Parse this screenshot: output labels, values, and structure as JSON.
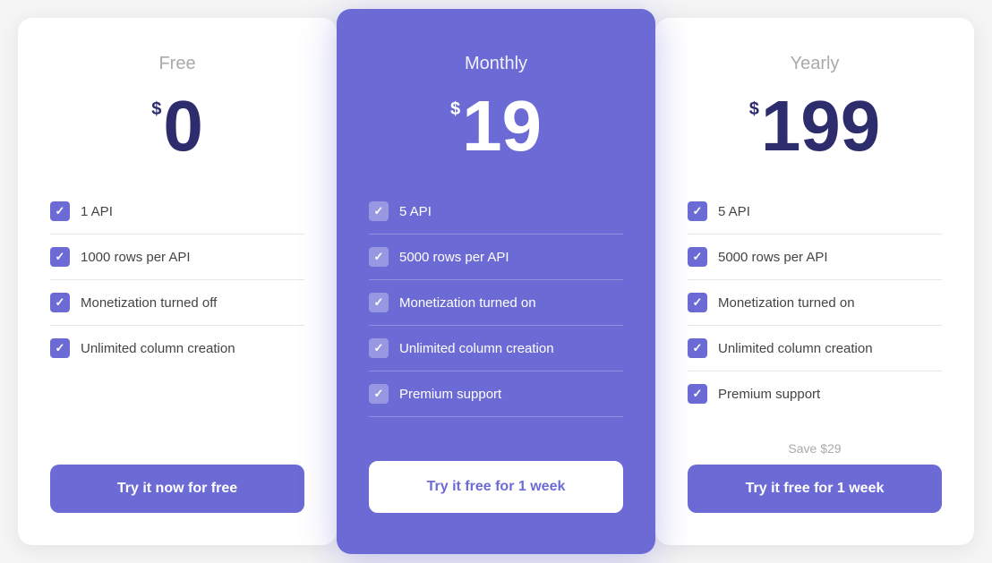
{
  "plans": [
    {
      "id": "free",
      "name": "Free",
      "price_symbol": "$",
      "price": "0",
      "highlighted": false,
      "features": [
        "1 API",
        "1000 rows per API",
        "Monetization turned off",
        "Unlimited column creation"
      ],
      "cta_label": "Try it now for free",
      "cta_style": "solid"
    },
    {
      "id": "monthly",
      "name": "Monthly",
      "price_symbol": "$",
      "price": "19",
      "highlighted": true,
      "features": [
        "5 API",
        "5000 rows per API",
        "Monetization turned on",
        "Unlimited column creation",
        "Premium support"
      ],
      "cta_label": "Try it free for 1 week",
      "cta_style": "outline"
    },
    {
      "id": "yearly",
      "name": "Yearly",
      "price_symbol": "$",
      "price": "199",
      "highlighted": false,
      "features": [
        "5 API",
        "5000 rows per API",
        "Monetization turned on",
        "Unlimited column creation",
        "Premium support"
      ],
      "save_text": "Save $29",
      "cta_label": "Try it free for 1 week",
      "cta_style": "solid"
    }
  ]
}
